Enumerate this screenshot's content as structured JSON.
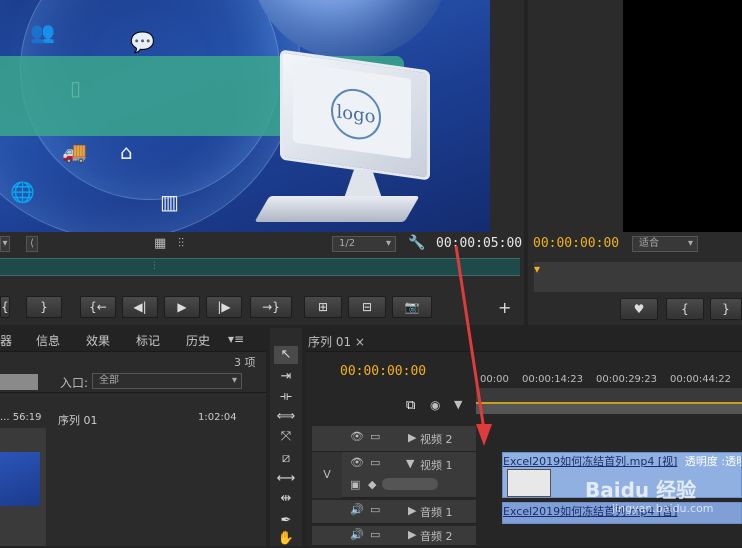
{
  "source_monitor": {
    "zoom_select": "1/2",
    "timecode": "00:00:05:00"
  },
  "program_monitor": {
    "timecode": "00:00:00:00",
    "fit_select": "适合"
  },
  "project_panel": {
    "tabs": [
      "器",
      "信息",
      "效果",
      "标记",
      "历史"
    ],
    "item_count": "3 项",
    "in_label": "入口:",
    "in_select": "全部",
    "items": [
      {
        "name": "... 56:19"
      },
      {
        "name": "序列 01",
        "duration": "1:02:04"
      }
    ]
  },
  "timeline": {
    "tab_label": "序列 01",
    "timecode": "00:00:00:00",
    "ruler_labels": [
      "00:00",
      "00:00:14:23",
      "00:00:29:23",
      "00:00:44:22"
    ],
    "tracks": [
      {
        "name": "视频 2"
      },
      {
        "name": "视频 1",
        "target": "V"
      },
      {
        "name": "音频 1"
      },
      {
        "name": "音频 2"
      }
    ],
    "video_clip_label": "Excel2019如何冻结首列.mp4 [视]",
    "video_clip_opacity": "透明度 :透明",
    "audio_clip_label": "Excel2019如何冻结首列.mp4 [音]"
  },
  "watermark": "Baidu 经验",
  "watermark_url": "jingyan.baidu.com",
  "colors": {
    "accent": "#f3b21c",
    "clip_video": "#8fb0e0",
    "clip_audio": "#7f9fd6",
    "scrub_bar": "#1f4a4a"
  }
}
